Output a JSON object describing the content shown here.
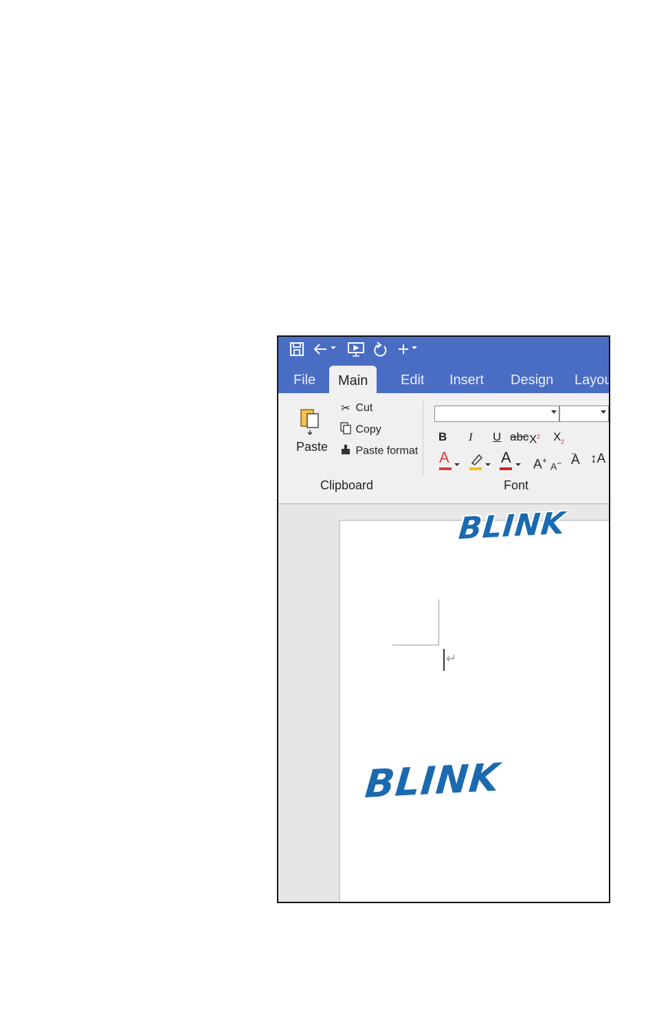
{
  "quick_access": {
    "icons": [
      "save-icon",
      "undo-icon",
      "dropdown-icon",
      "present-icon",
      "redo-icon",
      "add-icon",
      "dropdown-icon"
    ]
  },
  "tabs": [
    "File",
    "Main",
    "Edit",
    "Insert",
    "Design",
    "Layout"
  ],
  "active_tab": "Main",
  "clipboard": {
    "paste_label": "Paste",
    "cut_label": "Cut",
    "copy_label": "Copy",
    "paste_format_label": "Paste format",
    "group_label": "Clipboard"
  },
  "font": {
    "group_label": "Font",
    "font_name_value": "",
    "font_size_value": "",
    "bold": "B",
    "italic": "I",
    "underline": "U",
    "strikethrough": "abc",
    "superscript": "X",
    "subscript": "X",
    "text_effect": "A",
    "font_color": "A",
    "grow": "A",
    "shrink": "A",
    "clear": "A",
    "case": "A",
    "colors": {
      "effect_red": "#e03a3a",
      "highlight_yellow": "#f4c400",
      "font_color_red": "#d62020"
    }
  },
  "colors": {
    "title_bar": "#4a6dc4",
    "ribbon": "#f0f0f0",
    "sfx_blue": "#1a6ab0"
  },
  "sfx": {
    "top": "BLINK",
    "bottom": "BLINK"
  }
}
